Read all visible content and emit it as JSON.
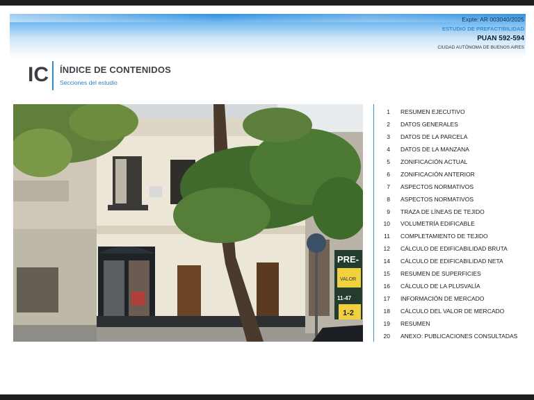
{
  "header": {
    "expte": "Expte: AR 003040/2025",
    "estudio": "ESTUDIO DE PREFACTIBILIDAD",
    "puan": "PUAN 592-594",
    "ciudad": "CIUDAD AUTÓNOMA DE BUENOS AIRES"
  },
  "section": {
    "code": "IC",
    "title": "ÍNDICE DE CONTENIDOS",
    "subtitle": "Secciones del estudio"
  },
  "photo": {
    "sign_text": "PRE-",
    "sign_line1": "VALOR",
    "sign_phone": "11-47",
    "sign_num": "1-2"
  },
  "toc": [
    {
      "num": "1",
      "label": "RESUMEN EJECUTIVO"
    },
    {
      "num": "2",
      "label": "DATOS GENERALES"
    },
    {
      "num": "3",
      "label": "DATOS DE LA PARCELA"
    },
    {
      "num": "4",
      "label": "DATOS DE LA MANZANA"
    },
    {
      "num": "5",
      "label": "ZONIFICACIÓN ACTUAL"
    },
    {
      "num": "6",
      "label": "ZONIFICACIÓN ANTERIOR"
    },
    {
      "num": "7",
      "label": "ASPECTOS NORMATIVOS"
    },
    {
      "num": "8",
      "label": "ASPECTOS NORMATIVOS"
    },
    {
      "num": "9",
      "label": "TRAZA DE LÍNEAS DE TEJIDO"
    },
    {
      "num": "10",
      "label": "VOLUMETRÍA EDIFICABLE"
    },
    {
      "num": "11",
      "label": "COMPLETAMIENTO DE TEJIDO"
    },
    {
      "num": "12",
      "label": "CÁLCULO DE EDIFICABILIDAD BRUTA"
    },
    {
      "num": "14",
      "label": "CÁLCULO DE EDIFICABILIDAD NETA"
    },
    {
      "num": "15",
      "label": "RESUMEN DE SUPERFICIES"
    },
    {
      "num": "16",
      "label": "CÁLCULO DE LA PLUSVALÍA"
    },
    {
      "num": "17",
      "label": "INFORMACIÓN DE MERCADO"
    },
    {
      "num": "18",
      "label": "CÁLCULO DEL VALOR DE MERCADO"
    },
    {
      "num": "19",
      "label": "RESUMEN"
    },
    {
      "num": "20",
      "label": "ANEXO: PUBLICACIONES CONSULTADAS"
    }
  ]
}
